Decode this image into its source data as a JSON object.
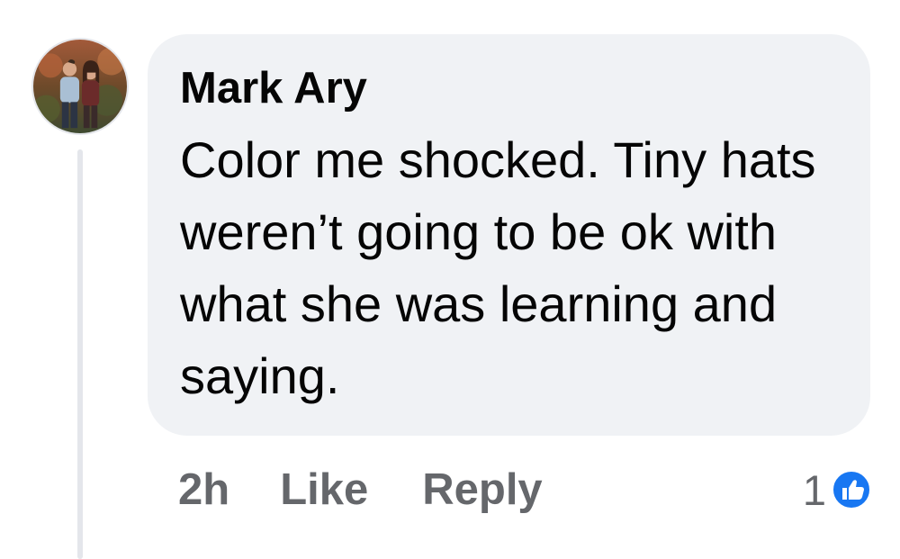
{
  "comment": {
    "author": "Mark Ary",
    "text": "Color me shocked. Tiny hats weren’t going to be ok with what she was learning and saying.",
    "timestamp": "2h",
    "like_label": "Like",
    "reply_label": "Reply",
    "reaction_count": "1",
    "reaction_icon": "like-icon"
  },
  "colors": {
    "bubble_bg": "#f0f2f5",
    "action_text": "#65676b",
    "like_blue": "#1877f2"
  }
}
